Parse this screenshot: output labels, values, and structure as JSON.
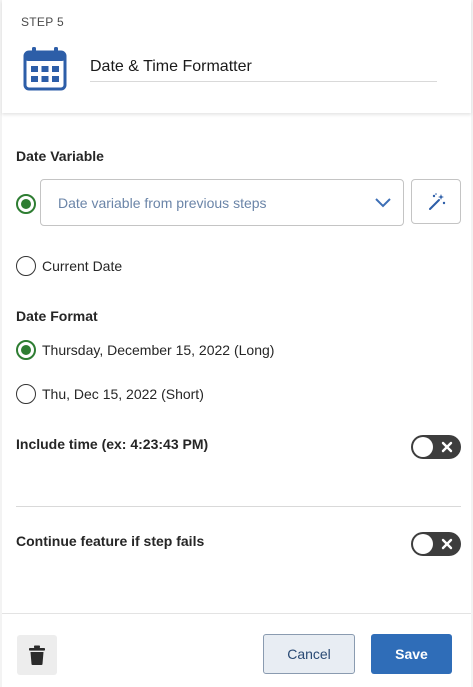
{
  "header": {
    "step_label": "STEP 5",
    "title": "Date & Time Formatter",
    "icon": "calendar-icon",
    "icon_color": "#2d5ea8"
  },
  "date_variable": {
    "section_title": "Date Variable",
    "select_placeholder": "Date variable from previous steps",
    "current_date_label": "Current Date",
    "magic_button_icon": "magic-wand-icon",
    "selected": "variable"
  },
  "date_format": {
    "section_title": "Date Format",
    "options": [
      {
        "label": "Thursday, December 15, 2022 (Long)",
        "selected": true
      },
      {
        "label": "Thu, Dec 15, 2022 (Short)",
        "selected": false
      }
    ]
  },
  "include_time": {
    "label": "Include time (ex: 4:23:43 PM)",
    "enabled": false
  },
  "continue_on_fail": {
    "label": "Continue feature if step fails",
    "enabled": false
  },
  "footer": {
    "delete_icon": "trash-icon",
    "cancel_label": "Cancel",
    "save_label": "Save"
  },
  "colors": {
    "accent_green": "#2e7d32",
    "primary_blue": "#2f6db8",
    "placeholder_blue": "#6b85a8",
    "toggle_off": "#3d3d3d"
  }
}
